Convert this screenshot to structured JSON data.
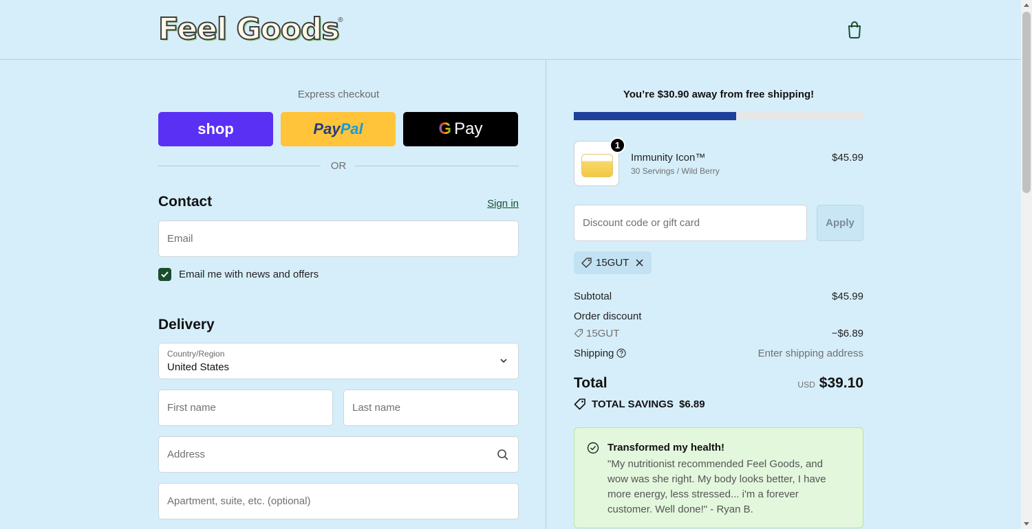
{
  "brand": {
    "logo_text": "Feel Goods",
    "logo_mark": "®"
  },
  "header": {
    "cart_icon": "shopping-bag-icon"
  },
  "express": {
    "label": "Express checkout",
    "shop_label": "shop",
    "paypal_part1": "Pay",
    "paypal_part2": "Pal",
    "gpay_g": "G",
    "gpay_label": "Pay",
    "or_text": "OR"
  },
  "contact": {
    "title": "Contact",
    "sign_in": "Sign in",
    "email_placeholder": "Email",
    "newsletter_label": "Email me with news and offers",
    "newsletter_checked": true
  },
  "delivery": {
    "title": "Delivery",
    "country_label": "Country/Region",
    "country_value": "United States",
    "first_name_placeholder": "First name",
    "last_name_placeholder": "Last name",
    "address_placeholder": "Address",
    "apartment_placeholder": "Apartment, suite, etc. (optional)"
  },
  "summary": {
    "shipping_message": "You’re $30.90 away from free shipping!",
    "shipping_progress": 0.56,
    "item": {
      "quantity": "1",
      "name": "Immunity Icon™",
      "variant": "30 Servings / Wild Berry",
      "price": "$45.99"
    },
    "discount_placeholder": "Discount code or gift card",
    "apply_label": "Apply",
    "applied_code": "15GUT",
    "subtotal_label": "Subtotal",
    "subtotal_value": "$45.99",
    "order_discount_label": "Order discount",
    "discount_code": "15GUT",
    "discount_value": "−$6.89",
    "shipping_label": "Shipping",
    "shipping_value": "Enter shipping address",
    "total_label": "Total",
    "currency": "USD",
    "total_value": "$39.10",
    "savings_label": "TOTAL SAVINGS",
    "savings_value": "$6.89"
  },
  "review": {
    "title": "Transformed my health!",
    "text": "\"My nutritionist recommended Feel Goods, and wow was she right. My body looks better, I have more energy, less stressed... i'm a forever customer. Well done!\" - Ryan B."
  },
  "colors": {
    "background": "#d6eefa",
    "shop_purple": "#5a31f4",
    "paypal_yellow": "#ffc439",
    "progress_fill": "#1e3f9a",
    "checkbox_green": "#1a4d2e",
    "review_bg": "#e2f7dc"
  }
}
